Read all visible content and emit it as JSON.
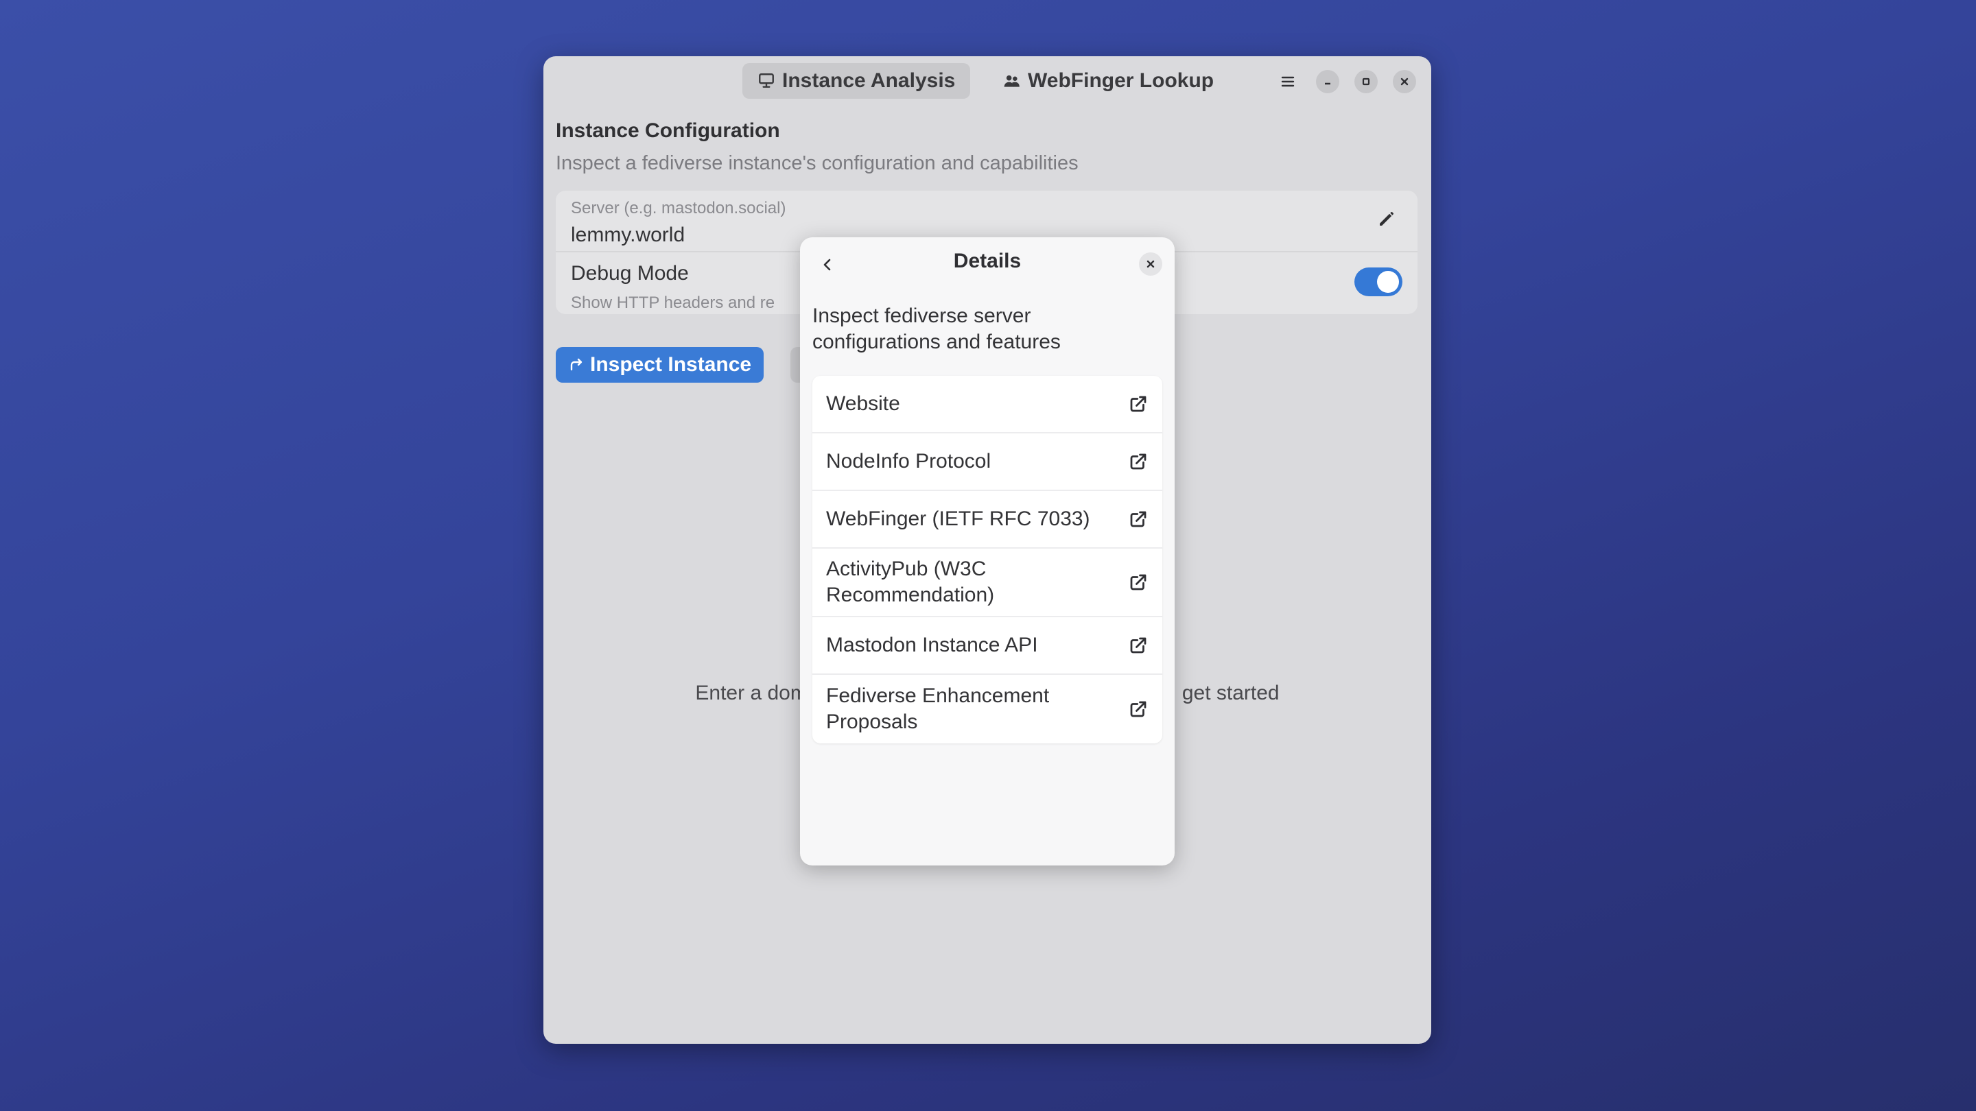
{
  "tabs": [
    {
      "label": "Instance Analysis",
      "icon": "monitor-icon",
      "active": true
    },
    {
      "label": "WebFinger Lookup",
      "icon": "people-icon",
      "active": false
    }
  ],
  "window_controls": [
    "menu-icon",
    "minimize-icon",
    "maximize-icon",
    "close-icon"
  ],
  "main": {
    "heading": "Instance Configuration",
    "subheading": "Inspect a fediverse instance's configuration and capabilities",
    "server_field": {
      "label": "Server (e.g. mastodon.social)",
      "value": "lemmy.world"
    },
    "debug": {
      "title": "Debug Mode",
      "subtitle": "Show HTTP headers and re",
      "enabled": true
    },
    "inspect_button": "Inspect Instance",
    "empty_hint_left": "Enter a dom",
    "empty_hint_right": "get started"
  },
  "dialog": {
    "title": "Details",
    "description": "Inspect fediverse server configurations and features",
    "links": [
      {
        "label": "Website"
      },
      {
        "label": "NodeInfo Protocol"
      },
      {
        "label": "WebFinger (IETF RFC 7033)"
      },
      {
        "label": "ActivityPub (W3C Recommendation)"
      },
      {
        "label": "Mastodon Instance API"
      },
      {
        "label": "Fediverse Enhancement Proposals"
      }
    ]
  },
  "colors": {
    "accent": "#3a7bd6",
    "window_bg": "#dadadd",
    "dialog_bg": "#f7f7f8"
  }
}
